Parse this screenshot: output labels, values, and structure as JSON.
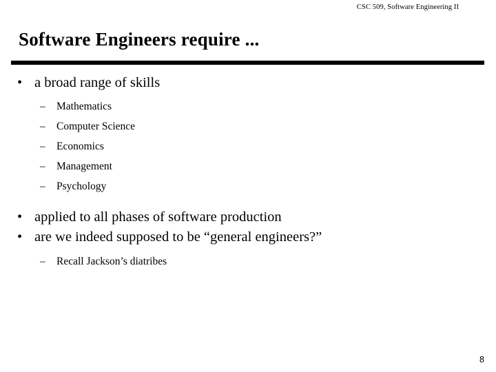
{
  "header": {
    "course_line": "CSC 509, Software Engineering II"
  },
  "title": "Software Engineers require ...",
  "body": {
    "bullet_marker": "•",
    "dash_marker": "–",
    "items": [
      {
        "level": 1,
        "text": "a broad range of skills"
      },
      {
        "level": 2,
        "text": "Mathematics"
      },
      {
        "level": 2,
        "text": "Computer Science"
      },
      {
        "level": 2,
        "text": "Economics"
      },
      {
        "level": 2,
        "text": "Management"
      },
      {
        "level": 2,
        "text": "Psychology"
      },
      {
        "level": 1,
        "text": "applied to all phases of software production"
      },
      {
        "level": 1,
        "text": "are we indeed supposed to be “general engineers?”"
      },
      {
        "level": 2,
        "text": "Recall Jackson’s diatribes"
      }
    ]
  },
  "footer": {
    "page_number": "8"
  }
}
